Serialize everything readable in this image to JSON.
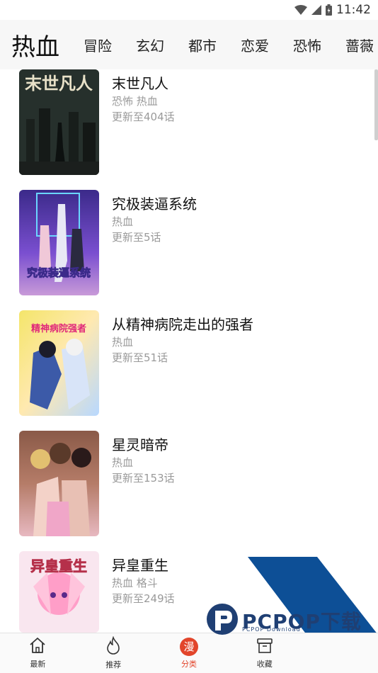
{
  "status": {
    "time": "11:42"
  },
  "categories": {
    "active": "热血",
    "items": [
      "冒险",
      "玄幻",
      "都市",
      "恋爱",
      "恐怖",
      "蔷薇"
    ]
  },
  "comics": [
    {
      "title": "末世凡人",
      "tags": "恐怖 热血",
      "update": "更新至404话",
      "cover_text": "末世凡人"
    },
    {
      "title": "究极装逼系统",
      "tags": "热血",
      "update": "更新至5话",
      "cover_text": "究极装逼系统"
    },
    {
      "title": "从精神病院走出的强者",
      "tags": "热血",
      "update": "更新至51话",
      "cover_text": "精神病院强者"
    },
    {
      "title": "星灵暗帝",
      "tags": "热血",
      "update": "更新至153话",
      "cover_text": ""
    },
    {
      "title": "异皇重生",
      "tags": "热血 格斗",
      "update": "更新至249话",
      "cover_text": "异皇重生"
    }
  ],
  "tabbar": {
    "tabs": [
      {
        "label": "最新",
        "icon": "home-icon"
      },
      {
        "label": "推荐",
        "icon": "flame-icon"
      },
      {
        "label": "分类",
        "icon": "manga-badge-icon",
        "badge": "漫"
      },
      {
        "label": "收藏",
        "icon": "box-icon"
      }
    ]
  },
  "watermark": {
    "brand": "PCPOP下载",
    "sub": "PCPOP Download"
  },
  "colors": {
    "accent": "#e2452b",
    "watermark": "#0d4f96"
  }
}
